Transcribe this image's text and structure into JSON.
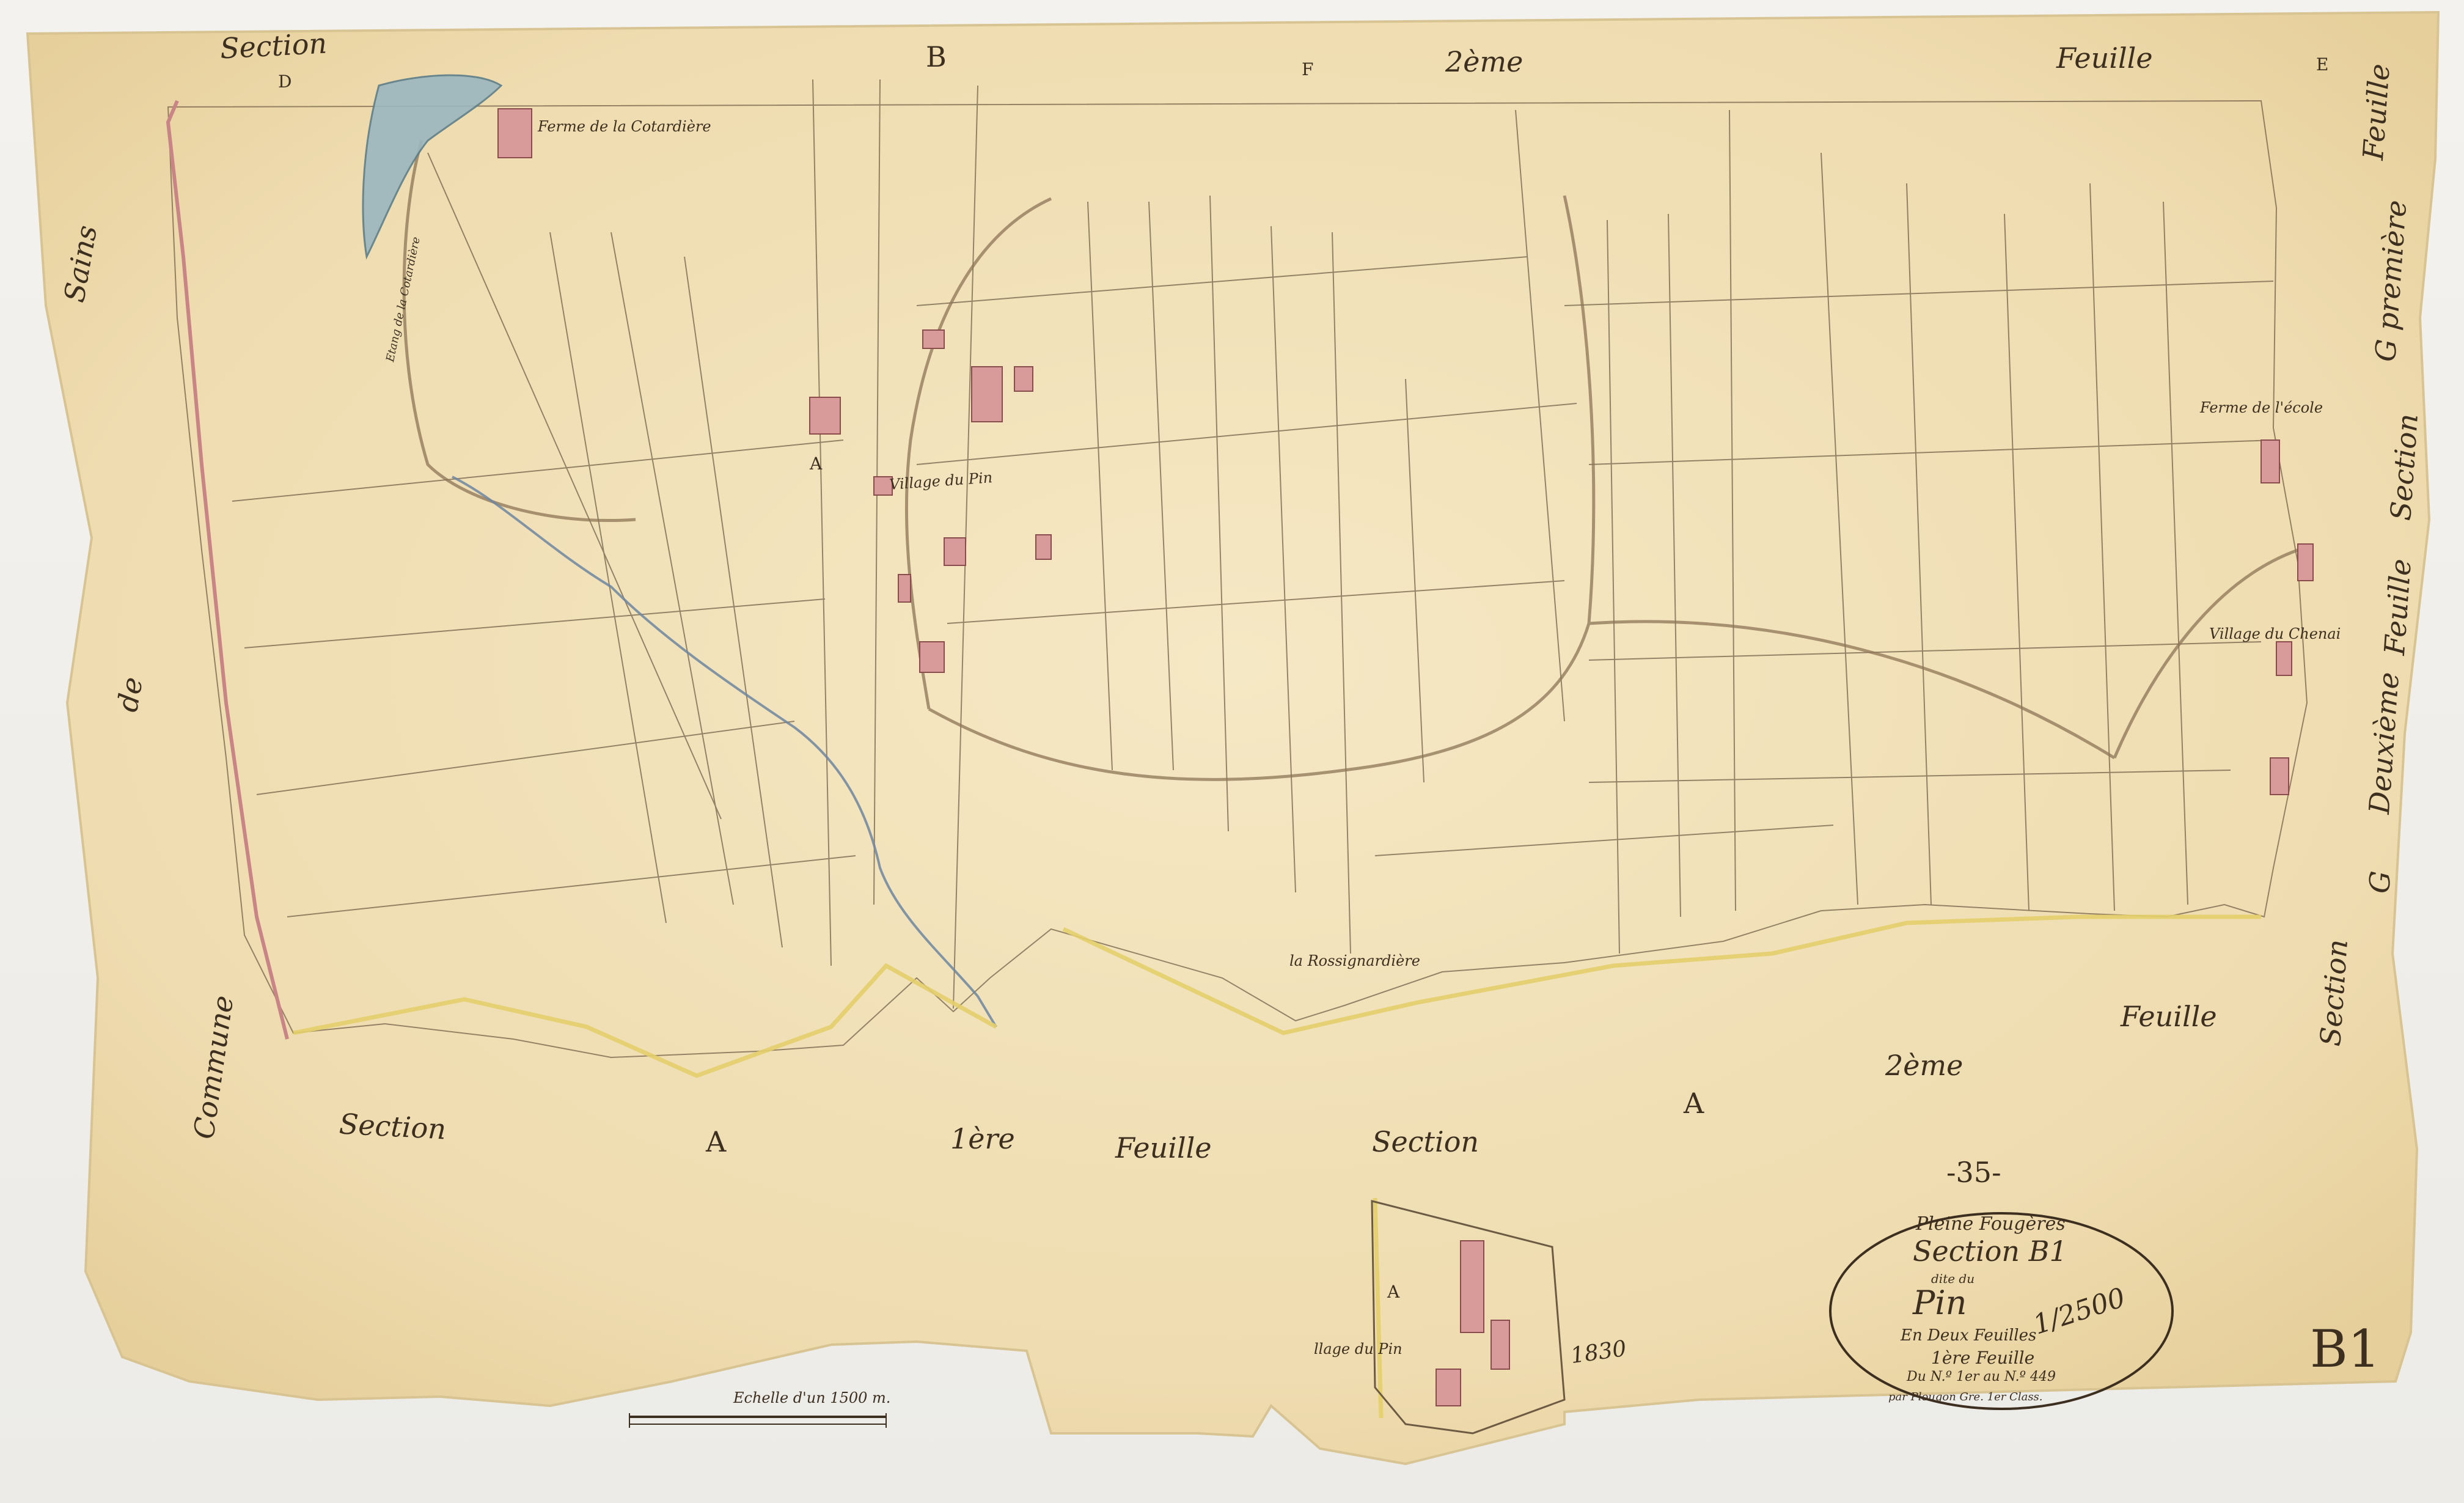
{
  "map": {
    "sheet_number": "-35-",
    "corner_mark": "B1",
    "cartouche": {
      "commune": "Pleine Fougères",
      "section": "Section B1",
      "dite_du": "dite du",
      "name": "Pin",
      "sheets": "En Deux Feuilles",
      "sheet": "1ère Feuille",
      "parcels": "Du N.º 1er au N.º 449",
      "surveyor": "par Plougon Gre. 1er Class.",
      "scale": "1/2500"
    },
    "scale_bar": {
      "title": "Echelle d'un 1500 m."
    },
    "colors": {
      "paper": "#f1e2bb",
      "ink": "#5a4631",
      "buildings": "#d99a9a",
      "pond": "#9ab7c0",
      "commune_border": "#c98585",
      "section_border": "#e3cf6b"
    },
    "places": {
      "village_du_pin": "Village du Pin",
      "ferme_cotardiere": "Ferme de la Cotardière",
      "etang": "Etang de la Cotardière",
      "ferme_ecole": "Ferme de l'école",
      "village_chenai": "Village du Chenai",
      "rossignardiere": "la Rossignardière",
      "village_du_pin_inset": "llage du Pin"
    },
    "border_labels": {
      "top_section": "Section",
      "top_d": "D",
      "top_b": "B",
      "top_f": "F",
      "top_2eme": "2ème",
      "top_feuille": "Feuille",
      "top_e": "E",
      "left_commune": "Commune",
      "left_de": "de",
      "left_sains": "Sains",
      "bottom_section_1": "Section",
      "bottom_a_1": "A",
      "bottom_1ere": "1ère",
      "bottom_feuille_1": "Feuille",
      "bottom_section_2": "Section",
      "bottom_a_2": "A",
      "bottom_2eme": "2ème",
      "bottom_feuille_2": "Feuille",
      "right_g_premiere": "G première",
      "right_feuille": "Feuille",
      "right_section": "Section",
      "right_deuxieme": "Deuxième",
      "right_feuille_2": "Feuille",
      "right_g": "G",
      "right_section_2": "Section",
      "parcel_a": "A",
      "inset_a": "A",
      "inset_number": "1830"
    }
  }
}
